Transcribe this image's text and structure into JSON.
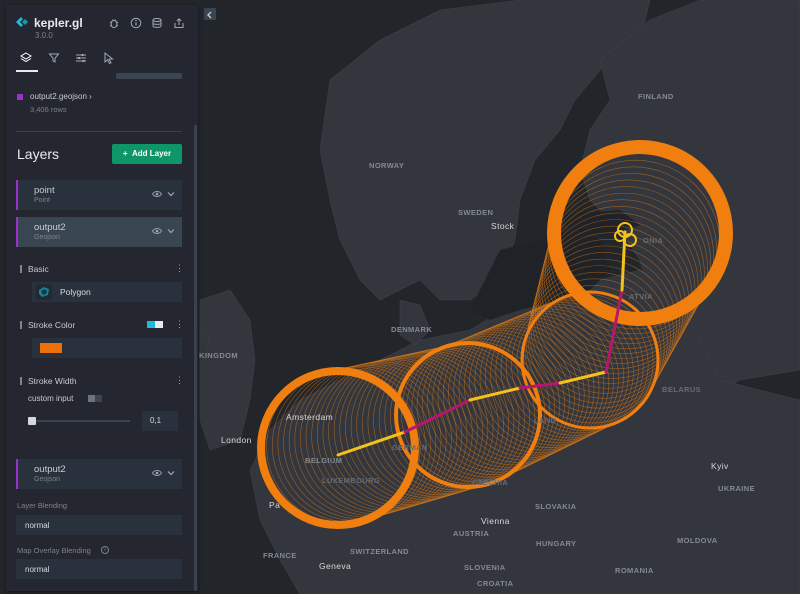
{
  "app": {
    "title": "kepler.gl",
    "version": "3.0.0"
  },
  "header_icons": [
    "bug-icon",
    "info-icon",
    "database-icon",
    "share-icon"
  ],
  "tabs": [
    {
      "name": "layers",
      "icon": "layers-icon",
      "active": true
    },
    {
      "name": "filters",
      "icon": "filter-icon",
      "active": false
    },
    {
      "name": "interactions",
      "icon": "sliders-icon",
      "active": false
    },
    {
      "name": "basemap",
      "icon": "cursor-icon",
      "active": false
    }
  ],
  "dataset": {
    "name": "output2.geojson",
    "chevron": "›",
    "rows": "3,406 rows",
    "color": "#9933cc"
  },
  "layers_section": {
    "title": "Layers",
    "add_label": "Add Layer",
    "add_icon": "+"
  },
  "layers": [
    {
      "name": "point",
      "type": "Point"
    },
    {
      "name": "output2",
      "type": "Geojson"
    },
    {
      "name": "output2",
      "type": "Geojson"
    }
  ],
  "layer_config": {
    "basic_label": "Basic",
    "polygon_label": "Polygon",
    "stroke_color_label": "Stroke Color",
    "stroke_color": "#ee6e0a",
    "stroke_width_label": "Stroke Width",
    "custom_input_label": "custom input",
    "stroke_width_value": "0,1",
    "stroke_width_slider": 0.0
  },
  "blending": {
    "layer_label": "Layer Blending",
    "layer_value": "normal",
    "overlay_label": "Map Overlay Blending",
    "overlay_value": "normal"
  },
  "map": {
    "labels": {
      "finland": "FINLAND",
      "norway": "NORWAY",
      "sweden": "SWEDEN",
      "stockholm": "Stock",
      "estonia": "ONIA",
      "latvia": "ATVIA",
      "denmark": "DENMARK",
      "kingdom": "KINGDOM",
      "belarus": "BELARUS",
      "amsterdam": "Amsterdam",
      "london": "London",
      "belgium": "BELGIUM",
      "germany": "GERMAN",
      "poland": "LAND",
      "luxembourg": "LUXEMBOURG",
      "czechia": "CZECHIA",
      "kyiv": "Kyiv",
      "ukraine": "UKRAINE",
      "paris": "Pa",
      "slovakia": "SLOVAKIA",
      "vienna": "Vienna",
      "austria": "AUSTRIA",
      "hungary": "HUNGARY",
      "moldova": "MOLDOVA",
      "france": "FRANCE",
      "switzerland": "SWITZERLAND",
      "geneva": "Geneva",
      "slovenia": "SLOVENIA",
      "croatia": "CROATIA",
      "romania": "ROMANIA"
    },
    "ring_color": "#f07f10",
    "path_color_a": "#f5c21b",
    "path_color_b": "#b5176b"
  }
}
